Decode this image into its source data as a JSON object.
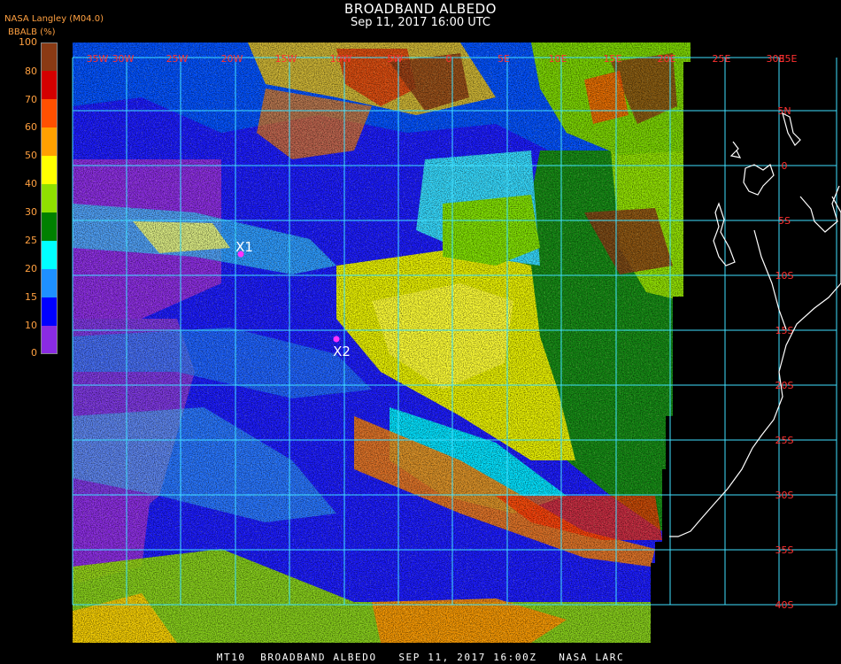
{
  "header": {
    "title": "BROADBAND ALBEDO",
    "subtitle": "Sep 11, 2017 16:00 UTC",
    "org": "NASA Langley (M04.0)",
    "product_label": "BBALB (%)"
  },
  "colorbar": {
    "ticks": [
      "100",
      "80",
      "70",
      "60",
      "50",
      "40",
      "30",
      "25",
      "20",
      "15",
      "10",
      "0"
    ],
    "bins": [
      {
        "color": "#8a3a14"
      },
      {
        "color": "#d40000"
      },
      {
        "color": "#ff5000"
      },
      {
        "color": "#ffa000"
      },
      {
        "color": "#ffff00"
      },
      {
        "color": "#90e000"
      },
      {
        "color": "#008000"
      },
      {
        "color": "#00ffff"
      },
      {
        "color": "#1e90ff"
      },
      {
        "color": "#0000ff"
      },
      {
        "color": "#8a2be2"
      }
    ]
  },
  "map": {
    "longitude_labels": [
      "35W",
      "30W",
      "25W",
      "20W",
      "15W",
      "10W",
      "5W",
      "0",
      "5E",
      "10E",
      "15E",
      "20E",
      "25E",
      "30E",
      "35E"
    ],
    "latitude_labels": [
      "5N",
      "0",
      "5S",
      "10S",
      "15S",
      "20S",
      "25S",
      "30S",
      "35S",
      "40S"
    ],
    "markers": [
      {
        "label": "X1",
        "color": "#ff33ff"
      },
      {
        "label": "X2",
        "color": "#ff33ff"
      }
    ],
    "grid_color": "#40e0ff",
    "lat_label_color": "#ff3030",
    "coastline_color": "#ffffff"
  },
  "footer": {
    "text": "MT10  BROADBAND ALBEDO   SEP 11, 2017 16:00Z   NASA LARC"
  }
}
